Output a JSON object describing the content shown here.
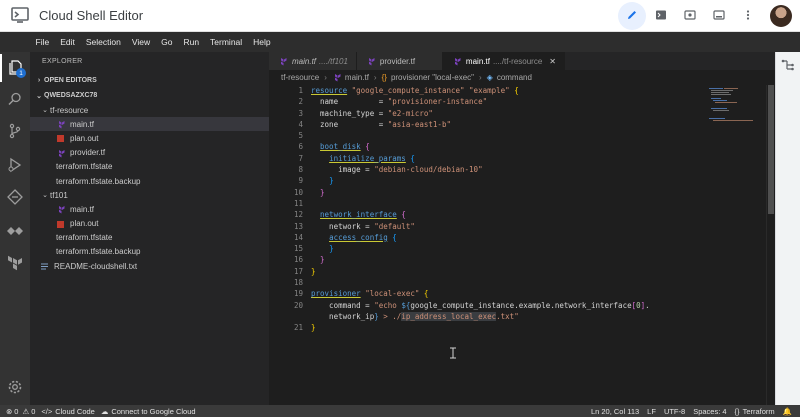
{
  "app": {
    "title": "Cloud Shell Editor"
  },
  "menu": [
    "File",
    "Edit",
    "Selection",
    "View",
    "Go",
    "Run",
    "Terminal",
    "Help"
  ],
  "activity": {
    "explorer_badge": "1"
  },
  "sidebar": {
    "title": "EXPLORER",
    "open_editors": "OPEN EDITORS",
    "workspace": "QWEDSAZXC78",
    "tree": [
      {
        "label": "tf-resource",
        "depth": 1,
        "kind": "folder",
        "open": true
      },
      {
        "label": "main.tf",
        "depth": 2,
        "kind": "tf",
        "selected": true
      },
      {
        "label": "plan.out",
        "depth": 2,
        "kind": "out"
      },
      {
        "label": "provider.tf",
        "depth": 2,
        "kind": "tf"
      },
      {
        "label": "terraform.tfstate",
        "depth": 2,
        "kind": "file"
      },
      {
        "label": "terraform.tfstate.backup",
        "depth": 2,
        "kind": "file"
      },
      {
        "label": "tf101",
        "depth": 1,
        "kind": "folder",
        "open": true
      },
      {
        "label": "main.tf",
        "depth": 2,
        "kind": "tf"
      },
      {
        "label": "plan.out",
        "depth": 2,
        "kind": "out"
      },
      {
        "label": "terraform.tfstate",
        "depth": 2,
        "kind": "file"
      },
      {
        "label": "terraform.tfstate.backup",
        "depth": 2,
        "kind": "file"
      },
      {
        "label": "README-cloudshell.txt",
        "depth": 1,
        "kind": "txt"
      }
    ]
  },
  "tabs": [
    {
      "name": "main.tf",
      "path": "..../tf101",
      "italic": true,
      "active": false
    },
    {
      "name": "provider.tf",
      "path": "",
      "italic": false,
      "active": false
    },
    {
      "name": "main.tf",
      "path": "..../tf-resource",
      "italic": false,
      "active": true
    }
  ],
  "breadcrumb": [
    "tf-resource",
    "main.tf",
    "provisioner \"local-exec\"",
    "command"
  ],
  "gutter": [
    "1",
    "2",
    "3",
    "4",
    "5",
    "6",
    "7",
    "8",
    "9",
    "10",
    "11",
    "12",
    "13",
    "14",
    "15",
    "16",
    "17",
    "18",
    "19",
    "20",
    "",
    "21"
  ],
  "status": {
    "problems": "0",
    "warnings": "0",
    "cloud_code": "Cloud Code",
    "connect": "Connect to Google Cloud",
    "position": "Ln 20, Col 113",
    "eol": "LF",
    "encoding": "UTF-8",
    "spaces": "Spaces: 4",
    "language": "Terraform"
  },
  "colors": {
    "accent": "#1a73e8",
    "terraform": "#7b42bc",
    "keyword": "#569cd6",
    "string": "#ce9178"
  }
}
